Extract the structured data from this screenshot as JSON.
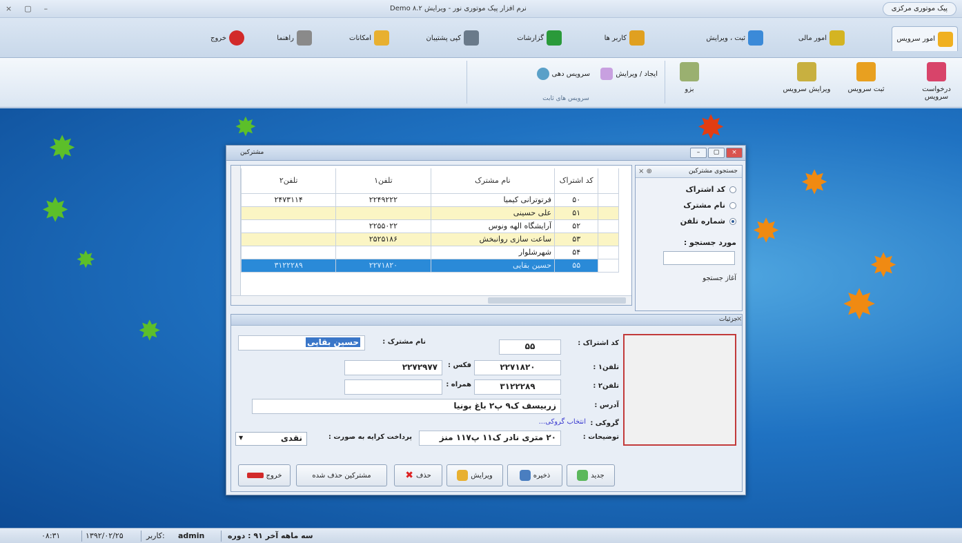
{
  "titlebar": {
    "controls": [
      "×",
      "▢",
      "–"
    ],
    "title": "Demo نرم افزار پیک موتوری نور - ویرایش ۸.۲",
    "quick_button": "پیک موتوری مرکزی"
  },
  "tabs": [
    {
      "label": "امور سرویس",
      "color": "#f0b020"
    },
    {
      "label": "امور مالی",
      "color": "#d4b422"
    },
    {
      "label": "ثبت ، ویرایش",
      "color": "#3b8ad8"
    },
    {
      "label": "کاربر ها",
      "color": "#e0a020"
    },
    {
      "label": "گزارشات",
      "color": "#2a9a3a"
    },
    {
      "label": "کپی پشتیبان",
      "color": "#6a7a8a"
    },
    {
      "label": "امکانات",
      "color": "#e8b030"
    },
    {
      "label": "راهنما",
      "color": "#8a8a8a"
    },
    {
      "label": "خروج",
      "color": "#d22a2a"
    }
  ],
  "ribbon": {
    "buttons": [
      {
        "label": "درخواست سرویس",
        "color": "#d8446a"
      },
      {
        "label": "ثبت سرویس",
        "color": "#e8a020"
      },
      {
        "label": "ویرایش سرویس",
        "color": "#c8b040"
      },
      {
        "label": "بزو",
        "color": "#9ab070"
      }
    ],
    "group": {
      "item1": "ایجاد / ویرایش",
      "item2": "سرویس دهی",
      "label": "سرویس های ثابت"
    }
  },
  "window": {
    "title": "مشترکین",
    "grid": {
      "headers": [
        "تلفن۲",
        "تلفن۱",
        "نام مشترک",
        "کد اشتراک"
      ],
      "rows": [
        {
          "t2": "۲۴۷۳۱۱۴",
          "t1": "۲۲۴۹۲۲۲",
          "name": "فرتوترانی کیمیا",
          "code": "۵۰",
          "style": "n"
        },
        {
          "t2": "",
          "t1": "",
          "name": "علی حسینی",
          "code": "۵۱",
          "style": "y"
        },
        {
          "t2": "",
          "t1": "۲۲۵۵۰۲۲",
          "name": "آرایشگاه الهه ونوس",
          "code": "۵۲",
          "style": "n"
        },
        {
          "t2": "",
          "t1": "۲۵۲۵۱۸۶",
          "name": "ساعت سازی روانبخش",
          "code": "۵۳",
          "style": "y"
        },
        {
          "t2": "",
          "t1": "",
          "name": "شهرشلوار",
          "code": "۵۴",
          "style": "n"
        },
        {
          "t2": "۳۱۲۲۲۸۹",
          "t1": "۲۲۷۱۸۲۰",
          "name": "حسین بقایی",
          "code": "۵۵",
          "style": "sel"
        }
      ]
    },
    "search": {
      "title": "جستجوی مشترکین",
      "options": [
        "کد اشتراک",
        "نام مشترک",
        "شماره تلفن"
      ],
      "selected_option": "شماره تلفن",
      "field_label": "مورد جستجو :",
      "start_label": "آغاز جستجو"
    },
    "details": {
      "title": "جزئیات",
      "code_label": "کد اشتراک :",
      "code": "۵۵",
      "name_label": "نام مشترک :",
      "name": "حسین بقایی",
      "phone1_label": "تلفن۱ :",
      "phone1": "۲۲۷۱۸۲۰",
      "fax_label": "فکس :",
      "fax": "۲۲۷۲۹۷۷",
      "phone2_label": "تلفن۲ :",
      "phone2": "۳۱۲۲۲۸۹",
      "mobile_label": "همراه :",
      "mobile": "",
      "address_label": "آدرس :",
      "address": "زربیسف ک۹ پ۲ باغ بونیا",
      "group_label": "گروکی :",
      "group_link": "انتخاب گروکی...",
      "notes_label": "توضیحات :",
      "notes": "۲۰ متری نادر ک۱۱ پ۱۱۷ منز",
      "payment_label": "پرداخت کرایه به صورت :",
      "payment": "نقدی"
    },
    "buttons": [
      "جدید",
      "ذخیره",
      "ویرایش",
      "حذف",
      "مشترکین حذف شده",
      "خروج"
    ]
  },
  "status": {
    "period": "سه ماهه آخر ۹۱ : دوره",
    "user_prefix": "کاربر:",
    "user": "admin",
    "date": "۱۳۹۲/۰۲/۲۵",
    "time": "۰۸:۳۱"
  }
}
